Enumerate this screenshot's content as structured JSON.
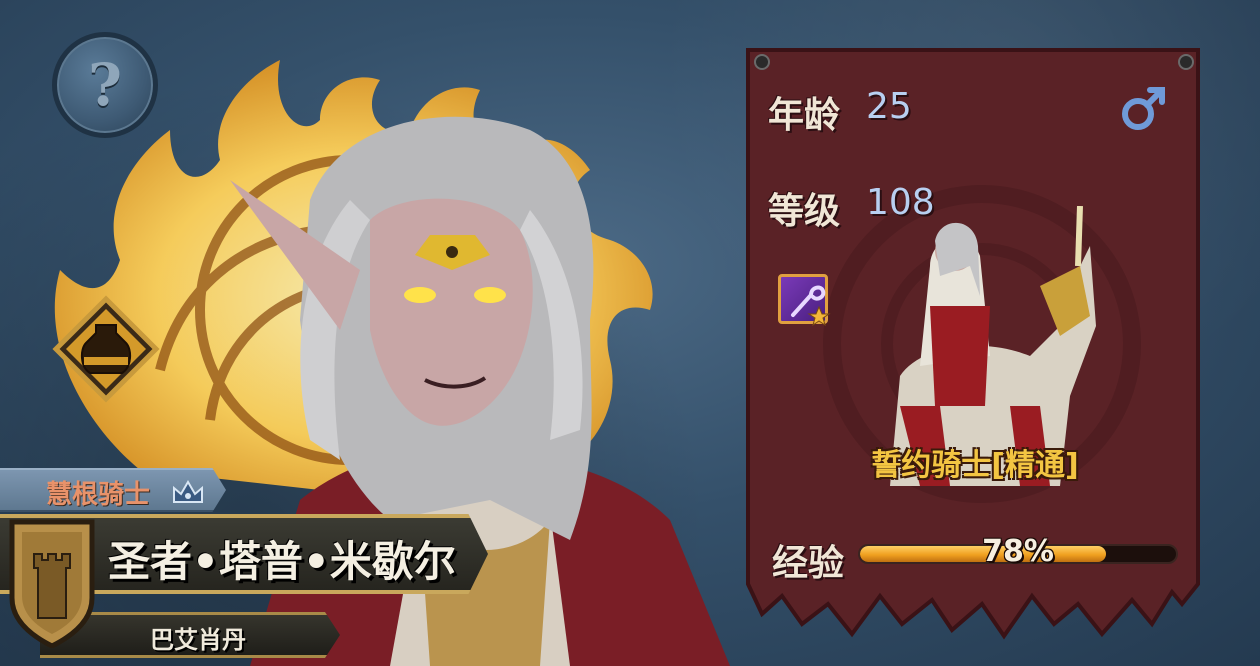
{
  "help": {
    "glyph": "?"
  },
  "hero": {
    "title": "慧根骑士",
    "name": "圣者•塔普•米歇尔",
    "faction": "巴艾肖丹"
  },
  "stats": {
    "age_label": "年龄",
    "age_value": "25",
    "level_label": "等级",
    "level_value": "108",
    "gender_icon": "male-symbol-icon",
    "skill_icon": "staff-star-icon",
    "class_name": "誓约骑士[精通]",
    "exp_label": "经验",
    "exp_text": "78%",
    "exp_fraction": 0.78
  },
  "colors": {
    "panel": "#5a2226",
    "exp_fill": "#f0a020",
    "class_gold": "#f3c542",
    "flame": "#ffd25a"
  }
}
